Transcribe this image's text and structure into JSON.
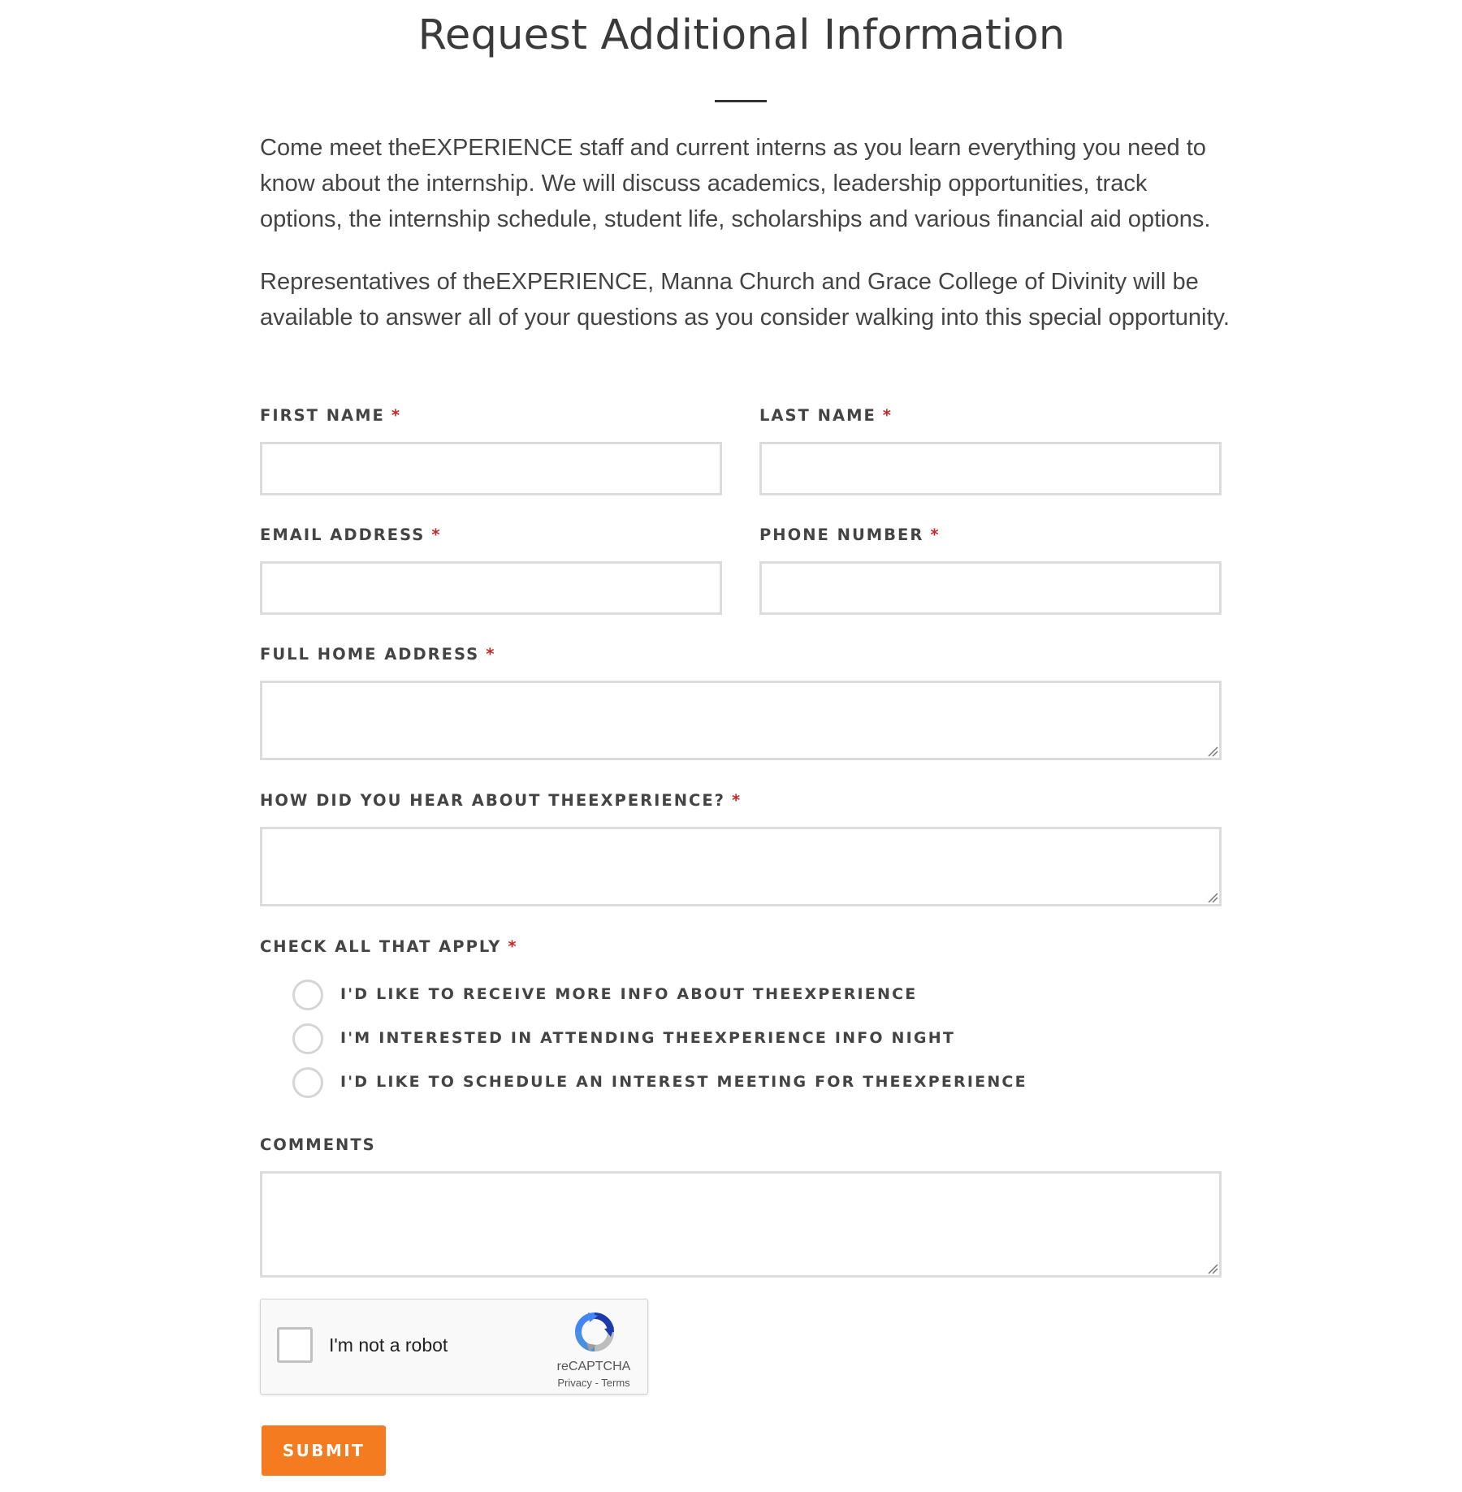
{
  "title": "Request Additional Information",
  "intro": {
    "paragraph_1": "Come meet theEXPERIENCE staff and current interns as you learn everything you need to know about the internship. We will discuss academics, leadership opportunities, track options, the internship schedule, student life, scholarships and various financial aid options.",
    "paragraph_2": "Representatives of theEXPERIENCE, Manna Church and Grace College of Divinity will be available to answer all of your questions as you consider walking into this special opportunity."
  },
  "form": {
    "required_marker": "*",
    "first_name": {
      "label": "FIRST NAME",
      "value": ""
    },
    "last_name": {
      "label": "LAST NAME",
      "value": ""
    },
    "email": {
      "label": "EMAIL ADDRESS",
      "value": ""
    },
    "phone": {
      "label": "PHONE NUMBER",
      "value": ""
    },
    "home_address": {
      "label": "FULL HOME ADDRESS",
      "value": ""
    },
    "heard_about": {
      "label": "HOW DID YOU HEAR ABOUT THEEXPERIENCE?",
      "value": ""
    },
    "check_all": {
      "label": "CHECK ALL THAT APPLY",
      "options": [
        {
          "label": "I'D LIKE TO RECEIVE MORE INFO ABOUT THEEXPERIENCE",
          "checked": false
        },
        {
          "label": "I'M INTERESTED IN ATTENDING THEEXPERIENCE INFO NIGHT",
          "checked": false
        },
        {
          "label": "I'D LIKE TO SCHEDULE AN INTEREST MEETING FOR THEEXPERIENCE",
          "checked": false
        }
      ]
    },
    "comments": {
      "label": "COMMENTS",
      "value": ""
    }
  },
  "recaptcha": {
    "checkbox_label": "I'm not a robot",
    "brand": "reCAPTCHA",
    "privacy": "Privacy",
    "separator": "-",
    "terms": "Terms",
    "checked": false
  },
  "submit_label": "SUBMIT",
  "colors": {
    "accent": "#f47b20",
    "required": "#c62828",
    "input_border": "#dcdcdc",
    "text": "#444444"
  }
}
